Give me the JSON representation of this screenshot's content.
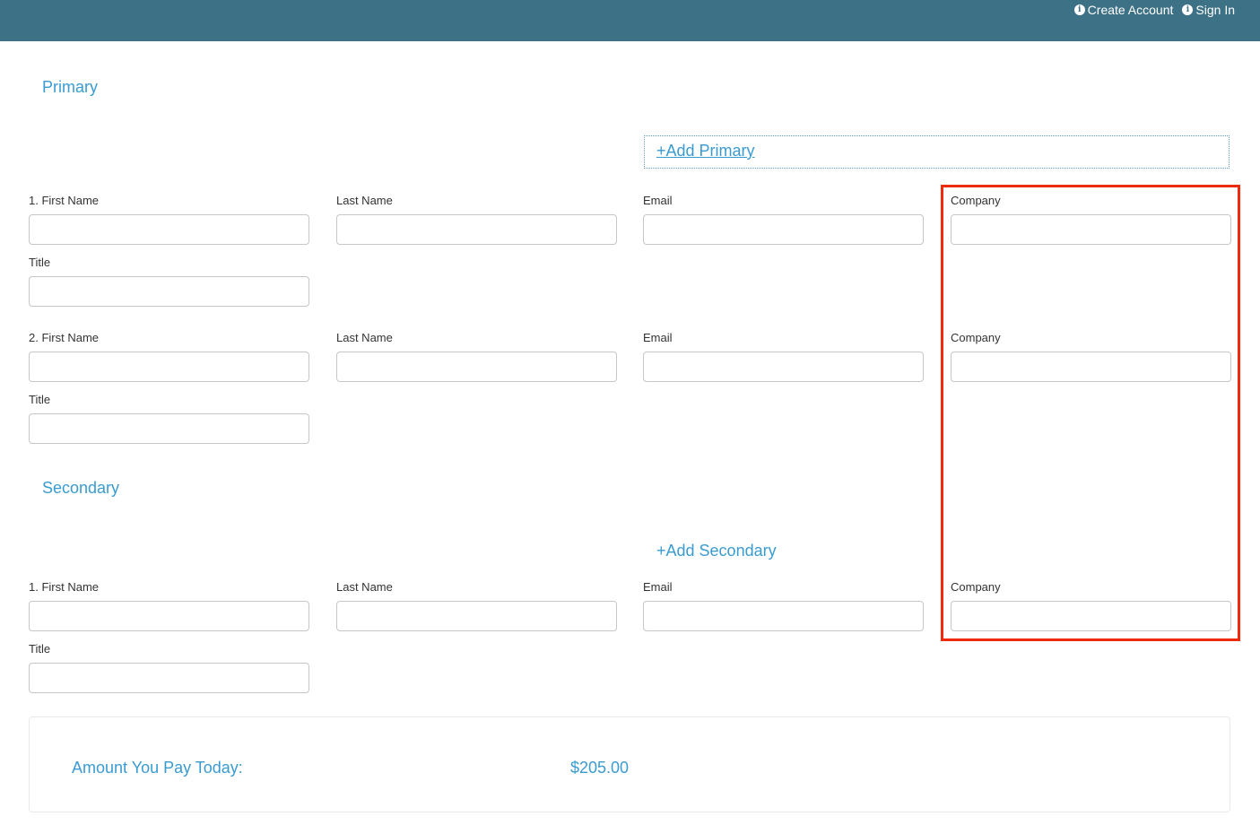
{
  "header": {
    "bg_color": "#3d7185",
    "links": [
      {
        "label": "Create Account",
        "icon": "info-icon"
      },
      {
        "label": "Sign In",
        "icon": "info-icon"
      }
    ]
  },
  "accent_color": "#3a9bd1",
  "highlight_color": "#ee2a0d",
  "primary": {
    "title": "Primary",
    "add_label": "+Add Primary",
    "attendees": [
      {
        "first_name_label": "1. First Name",
        "last_name_label": "Last Name",
        "email_label": "Email",
        "company_label": "Company",
        "title_label": "Title"
      },
      {
        "first_name_label": "2. First Name",
        "last_name_label": "Last Name",
        "email_label": "Email",
        "company_label": "Company",
        "title_label": "Title"
      }
    ]
  },
  "secondary": {
    "title": "Secondary",
    "add_label": "+Add Secondary",
    "attendees": [
      {
        "first_name_label": "1. First Name",
        "last_name_label": "Last Name",
        "email_label": "Email",
        "company_label": "Company",
        "title_label": "Title"
      }
    ]
  },
  "summary": {
    "label": "Amount You Pay Today:",
    "amount": "$205.00"
  }
}
